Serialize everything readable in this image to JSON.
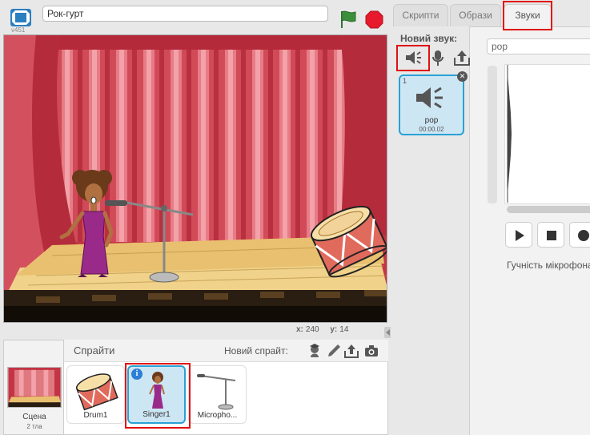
{
  "header": {
    "version": "v451",
    "project_title": "Рок-гурт"
  },
  "stage_info": {
    "x_label": "x:",
    "x_value": "240",
    "y_label": "y:",
    "y_value": "14"
  },
  "sprites_panel": {
    "title": "Спрайти",
    "new_sprite_label": "Новий спрайт:",
    "scene": {
      "label": "Сцена",
      "backdrops": "2 тла"
    },
    "sprites": [
      {
        "name": "Drum1",
        "selected": false
      },
      {
        "name": "Singer1",
        "selected": true
      },
      {
        "name": "Micropho...",
        "selected": false
      }
    ]
  },
  "tabs": [
    {
      "label": "Скрипти",
      "active": false
    },
    {
      "label": "Образи",
      "active": false
    },
    {
      "label": "Звуки",
      "active": true
    }
  ],
  "sounds": {
    "new_sound_label": "Новий звук:",
    "items": [
      {
        "index": "1",
        "name": "pop",
        "duration": "00:00.02"
      }
    ],
    "name_field_value": "pop",
    "mic_volume_label": "Гучність мікрофона"
  },
  "colors": {
    "highlight_red": "#e01010",
    "selection_blue": "#2aa1d6",
    "stop_red": "#e8192c",
    "flag_green": "#3b8f3b"
  }
}
